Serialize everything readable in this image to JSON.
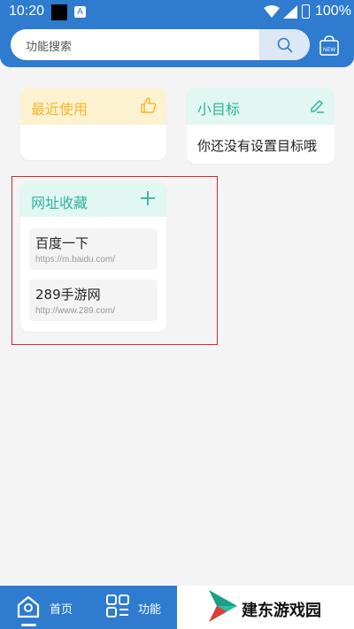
{
  "status": {
    "time": "10:20",
    "battery": "100%",
    "notif_letter": "A"
  },
  "search": {
    "placeholder": "功能搜索"
  },
  "header": {
    "icon": "new-store-icon",
    "icon_badge": "NEW"
  },
  "cards": {
    "recent": {
      "title": "最近使用",
      "icon": "thumbs-up-icon"
    },
    "goal": {
      "title": "小目标",
      "icon": "edit-icon",
      "empty_text": "你还没有设置目标哦"
    },
    "favorites": {
      "title": "网址收藏",
      "icon": "plus-icon",
      "items": [
        {
          "name": "百度一下",
          "url": "https://m.baidu.com/"
        },
        {
          "name": "289手游网",
          "url": "http://www.289.com/"
        }
      ]
    }
  },
  "tabbar": {
    "tabs": [
      {
        "label": "首页",
        "icon": "home-icon",
        "active": true
      },
      {
        "label": "功能",
        "icon": "grid-list-icon",
        "active": false
      }
    ]
  },
  "watermark": {
    "text": "建东游戏园"
  },
  "colors": {
    "primary": "#2e7bd0",
    "teal": "#2eb59a",
    "yellow": "#f5b82e",
    "highlight": "#d9232e"
  }
}
